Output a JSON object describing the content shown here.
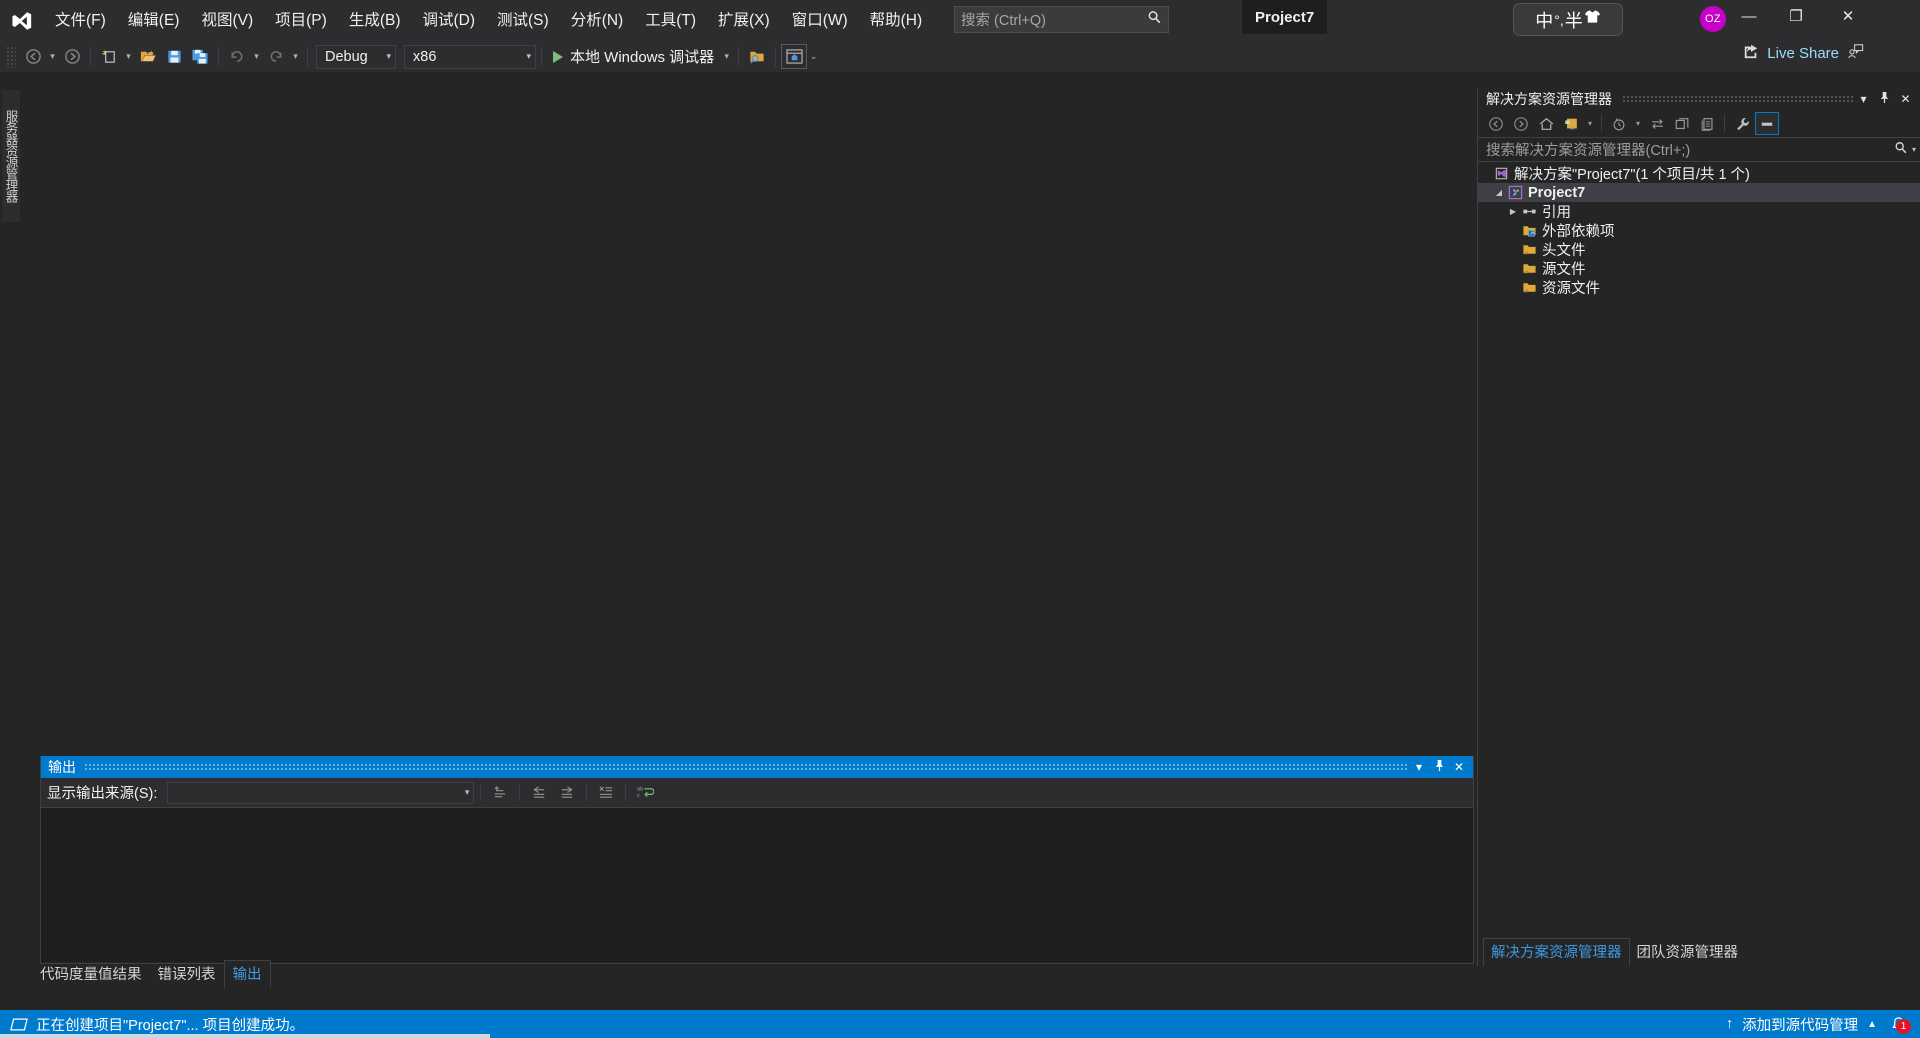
{
  "window": {
    "app_logo": "visual-studio-logo",
    "project_tab": "Project7",
    "user_initials": "OZ",
    "minimize": "—",
    "maximize": "❐",
    "close": "✕"
  },
  "menu": {
    "items": [
      {
        "label": "文件(F)"
      },
      {
        "label": "编辑(E)"
      },
      {
        "label": "视图(V)"
      },
      {
        "label": "项目(P)"
      },
      {
        "label": "生成(B)"
      },
      {
        "label": "调试(D)"
      },
      {
        "label": "测试(S)"
      },
      {
        "label": "分析(N)"
      },
      {
        "label": "工具(T)"
      },
      {
        "label": "扩展(X)"
      },
      {
        "label": "窗口(W)"
      },
      {
        "label": "帮助(H)"
      }
    ]
  },
  "quick_search": {
    "placeholder": "搜索 (Ctrl+Q)",
    "icon": "search-icon"
  },
  "ime": {
    "mode": "中",
    "punct": "°,",
    "width": "半",
    "extra_icon": "shirt-icon"
  },
  "toolbar": {
    "navigate_back": "nav-back-icon",
    "navigate_forward": "nav-forward-icon",
    "new_item": "new-item-icon",
    "open_file": "open-folder-icon",
    "save": "save-icon",
    "save_all": "save-all-icon",
    "undo": "undo-icon",
    "redo": "redo-icon",
    "configuration": "Debug",
    "platform": "x86",
    "run_label": "本地 Windows 调试器",
    "run_icon": "play-icon",
    "find_folder": "search-folder-icon",
    "preview_icon": "preview-window-icon",
    "overflow_icon": "toolbar-overflow-icon"
  },
  "live_share": {
    "label": "Live Share",
    "icon": "live-share-icon",
    "feedback_icon": "feedback-icon"
  },
  "left_dock": {
    "server_explorer_tab": "服务器资源管理器"
  },
  "output_panel": {
    "title": "输出",
    "dropdown_icon": "▾",
    "pin_icon": "pin-icon",
    "close_icon": "✕",
    "source_label": "显示输出来源(S):",
    "source_value": "",
    "tools": [
      {
        "name": "jump-to-source-icon",
        "glyph": "⤶"
      },
      {
        "name": "find-previous-message-icon",
        "glyph": "⇐"
      },
      {
        "name": "find-next-message-icon",
        "glyph": "⇒"
      },
      {
        "name": "clear-all-icon",
        "glyph": "✕"
      },
      {
        "name": "toggle-word-wrap-icon",
        "glyph": "ab"
      }
    ],
    "body_text": ""
  },
  "bottom_tabs": {
    "items": [
      {
        "label": "代码度量值结果",
        "active": false
      },
      {
        "label": "错误列表",
        "active": false
      },
      {
        "label": "输出",
        "active": true
      }
    ]
  },
  "solution_explorer": {
    "title": "解决方案资源管理器",
    "header_buttons": {
      "dropdown": "▾",
      "pin": "pin-icon",
      "close": "✕"
    },
    "tools": [
      {
        "name": "back-icon",
        "glyph": "←"
      },
      {
        "name": "forward-icon",
        "glyph": "→"
      },
      {
        "name": "home-icon",
        "glyph": "⌂"
      },
      {
        "name": "sync-with-active-document-icon",
        "glyph": "▣"
      },
      {
        "name": "pending-changes-filter-icon",
        "glyph": "◔"
      },
      {
        "name": "refresh-icon",
        "glyph": "⇆"
      },
      {
        "name": "collapse-all-icon",
        "glyph": "❐"
      },
      {
        "name": "show-all-files-icon",
        "glyph": "⎘"
      },
      {
        "name": "properties-icon",
        "glyph": "🔧"
      },
      {
        "name": "preview-selected-items-icon",
        "glyph": "▬"
      }
    ],
    "search_placeholder": "搜索解决方案资源管理器(Ctrl+;)",
    "search_icon": "search-icon",
    "search_dropdown": "▾",
    "tree": [
      {
        "label": "解决方案\"Project7\"(1 个项目/共 1 个)",
        "icon": "solution-icon",
        "indent": 0,
        "expander": "",
        "selected": false,
        "bold": false
      },
      {
        "label": "Project7",
        "icon": "cpp-project-icon",
        "indent": 1,
        "expander": "▲",
        "selected": true,
        "bold": true
      },
      {
        "label": "引用",
        "icon": "references-icon",
        "indent": 2,
        "expander": "▶",
        "selected": false,
        "bold": false
      },
      {
        "label": "外部依赖项",
        "icon": "external-dependencies-icon",
        "indent": 2,
        "expander": "",
        "selected": false,
        "bold": false
      },
      {
        "label": "头文件",
        "icon": "folder-icon",
        "indent": 2,
        "expander": "",
        "selected": false,
        "bold": false
      },
      {
        "label": "源文件",
        "icon": "folder-icon",
        "indent": 2,
        "expander": "",
        "selected": false,
        "bold": false
      },
      {
        "label": "资源文件",
        "icon": "folder-icon",
        "indent": 2,
        "expander": "",
        "selected": false,
        "bold": false
      }
    ],
    "bottom_tabs": [
      {
        "label": "解决方案资源管理器",
        "active": true
      },
      {
        "label": "团队资源管理器",
        "active": false
      }
    ]
  },
  "status_bar": {
    "icon": "ready-icon",
    "message": "正在创建项目\"Project7\"... 项目创建成功。",
    "source_control_label": "添加到源代码管理",
    "source_control_up_icon": "↑",
    "source_control_caret": "▲",
    "notification_icon": "bell-icon",
    "notification_count": "1"
  },
  "colors": {
    "accent": "#007acc",
    "chrome": "#2d2d30",
    "panel": "#252526",
    "editor": "#1e1e1e",
    "link": "#3d9ae0",
    "badge": "#e81123",
    "avatar": "#c800c8"
  }
}
